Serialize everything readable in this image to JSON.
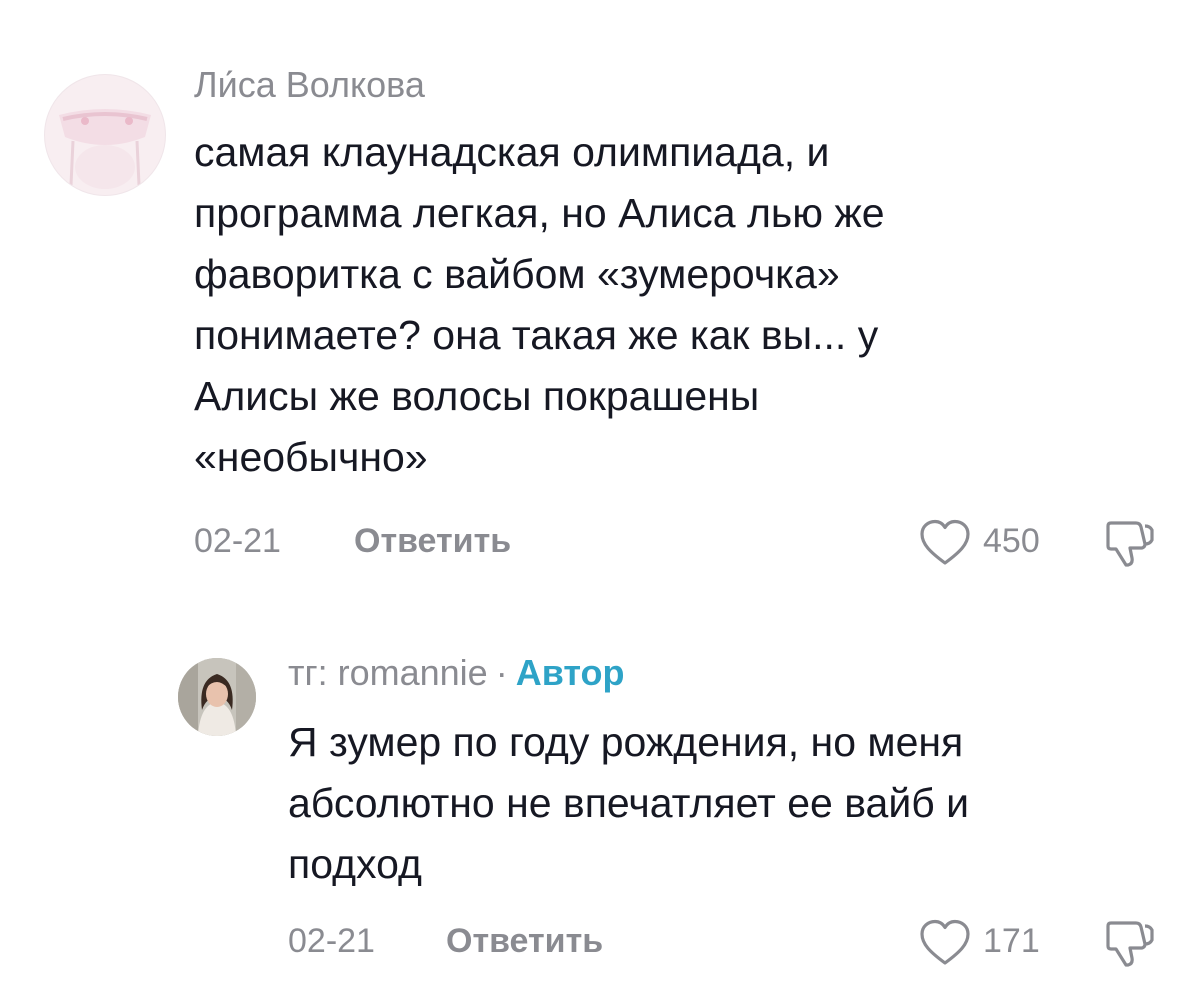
{
  "comments": [
    {
      "author": "Ли́са Волкова",
      "text_lines": [
        "самая клаунадская олимпиада, и",
        "программа легкая, но Алиса лью же",
        "фаворитка с вайбом «зумерочка»",
        "понимаете? она такая же как вы... у",
        "Алисы же волосы покрашены",
        "«необычно»"
      ],
      "date": "02-21",
      "reply_label": "Ответить",
      "likes": "450",
      "icons": {
        "like": "heart-outline-icon",
        "dislike": "thumbs-down-icon"
      }
    },
    {
      "author": "тг: romannie",
      "separator": "·",
      "author_tag": "Автор",
      "text_lines": [
        "Я зумер по году рождения, но меня",
        "абсолютно не впечатляет ее вайб и",
        "подход"
      ],
      "date": "02-21",
      "reply_label": "Ответить",
      "likes": "171",
      "icons": {
        "like": "heart-outline-icon",
        "dislike": "thumbs-down-icon"
      }
    }
  ],
  "colors": {
    "text": "#161823",
    "muted": "#8a8b91",
    "author_badge": "#2ea3c7",
    "background": "#ffffff"
  }
}
